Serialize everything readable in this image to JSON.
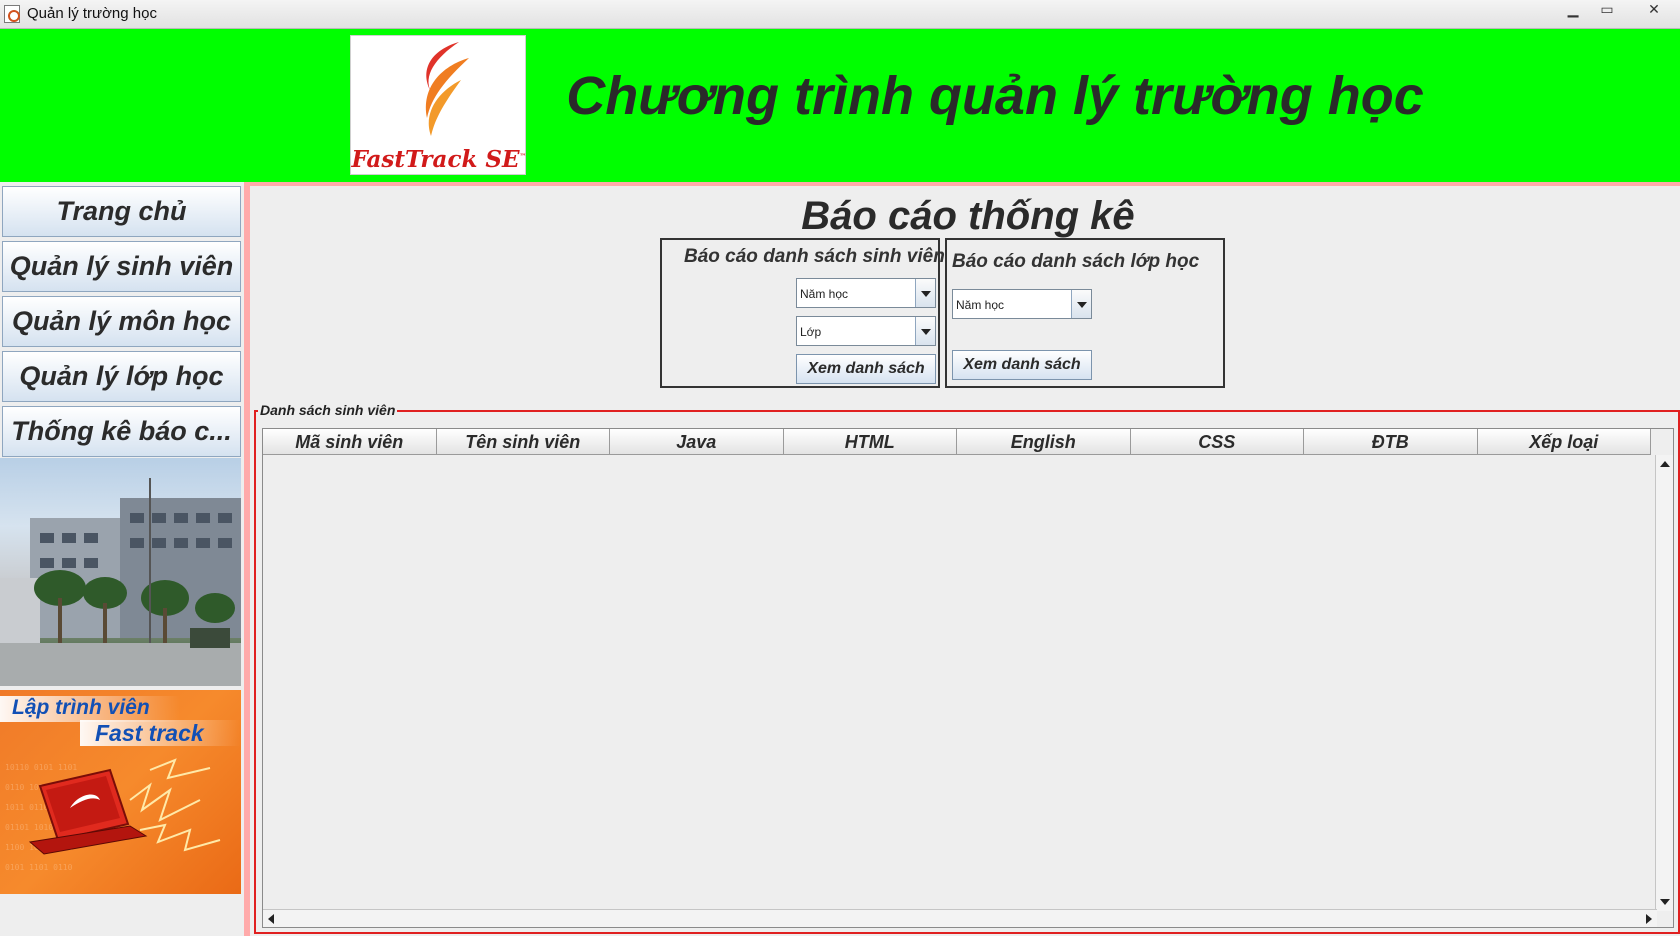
{
  "window": {
    "title": "Quản lý trường học"
  },
  "header": {
    "logo_text": "FastTrack SE",
    "logo_tm": "™",
    "heading": "Chương trình quản lý trường học"
  },
  "sidebar": {
    "items": [
      {
        "label": "Trang chủ"
      },
      {
        "label": "Quản lý sinh viên"
      },
      {
        "label": "Quản lý môn học"
      },
      {
        "label": "Quản lý lớp học"
      },
      {
        "label": "Thống kê báo c..."
      }
    ],
    "banner": {
      "line1": "Lập trình viên",
      "line2": "Fast track"
    }
  },
  "main": {
    "title": "Báo cáo thống kê",
    "student_report": {
      "title": "Báo cáo danh sách sinh viên",
      "year_select": "Năm học",
      "class_select": "Lớp",
      "view_button": "Xem danh sách"
    },
    "class_report": {
      "title": "Báo cáo danh sách lớp học",
      "year_select": "Năm học",
      "view_button": "Xem danh sách"
    },
    "student_list": {
      "legend": "Danh sách sinh viên",
      "columns": [
        "Mã sinh viên",
        "Tên sinh viên",
        "Java",
        "HTML",
        "English",
        "CSS",
        "ĐTB",
        "Xếp loại"
      ],
      "rows": []
    }
  },
  "colors": {
    "header_bg": "#00ff00",
    "panel_border": "#ffaaaa",
    "list_border": "#e02020",
    "logo_red": "#d11a1a"
  }
}
